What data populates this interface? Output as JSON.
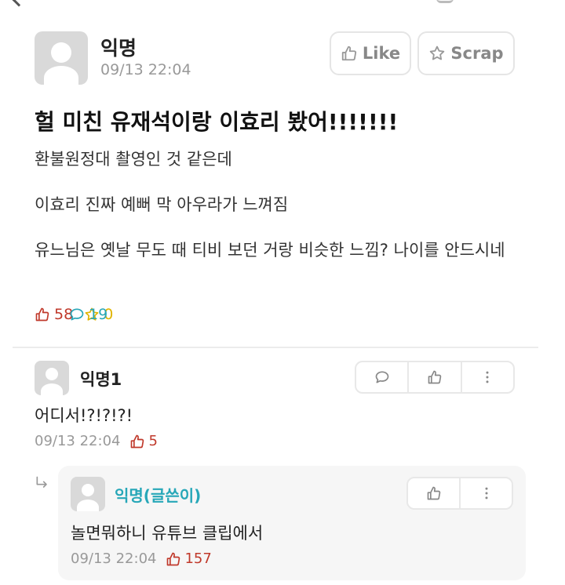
{
  "post": {
    "author": "익명",
    "date": "09/13 22:04",
    "like_label": "Like",
    "scrap_label": "Scrap",
    "title": "헐 미친 유재석이랑 이효리 봤어!!!!!!!",
    "body": [
      "환불원정대 촬영인 것 같은데",
      "이효리 진짜 예뻐 막 아우라가 느껴짐",
      "유느님은 옛날 무도 때 티비 보던 거랑 비슷한 느낌? 나이를 안드시네"
    ],
    "stats": {
      "likes": "58",
      "comments": "19",
      "scraps": "0"
    }
  },
  "comments": [
    {
      "author": "익명1",
      "text": "어디서!?!?!?!",
      "date": "09/13 22:04",
      "likes": "5",
      "replies": [
        {
          "author": "익명(글쓴이)",
          "text": "놀면뭐하니 유튜브 클립에서",
          "date": "09/13 22:04",
          "likes": "157"
        }
      ]
    }
  ],
  "colors": {
    "like": "#c0392b",
    "comment": "#27a7b8",
    "scrap": "#e0b400",
    "op_name": "#27a7b8",
    "muted": "#999999"
  },
  "icons": [
    "thumbs-up-icon",
    "star-icon",
    "comment-bubble-icon",
    "more-vertical-icon",
    "reply-arrow-icon",
    "avatar-icon"
  ]
}
